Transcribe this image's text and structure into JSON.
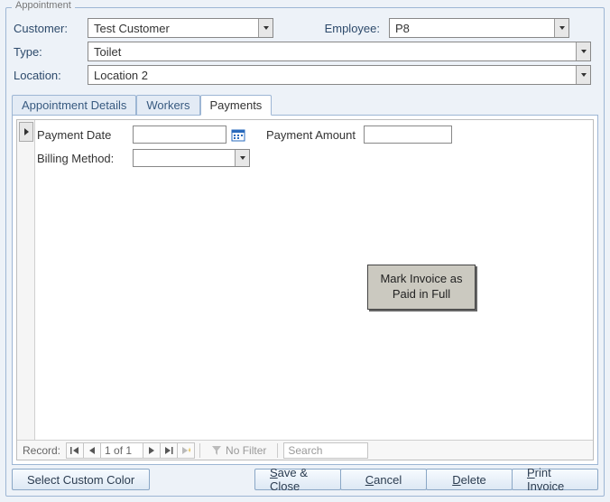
{
  "group_title": "Appointment",
  "form": {
    "customer_label": "Customer:",
    "customer_value": "Test Customer",
    "employee_label": "Employee:",
    "employee_value": "P8",
    "type_label": "Type:",
    "type_value": "Toilet",
    "location_label": "Location:",
    "location_value": "Location 2"
  },
  "tabs": [
    {
      "label": "Appointment Details"
    },
    {
      "label": "Workers"
    },
    {
      "label": "Payments"
    }
  ],
  "payments": {
    "payment_date_label": "Payment Date",
    "payment_date_value": "",
    "payment_amount_label": "Payment Amount",
    "payment_amount_value": "",
    "billing_method_label": "Billing Method:",
    "billing_method_value": "",
    "mark_invoice_button": "Mark Invoice as Paid in Full"
  },
  "recordnav": {
    "label": "Record:",
    "position": "1 of 1",
    "no_filter": "No Filter",
    "search_placeholder": "Search"
  },
  "footer": {
    "select_color": "Select Custom Color",
    "save_close": "Save & Close",
    "cancel": "Cancel",
    "delete": "Delete",
    "print_invoice": "Print Invoice",
    "save_close_key": "S",
    "cancel_key": "C",
    "delete_key": "D",
    "print_key": "P"
  }
}
